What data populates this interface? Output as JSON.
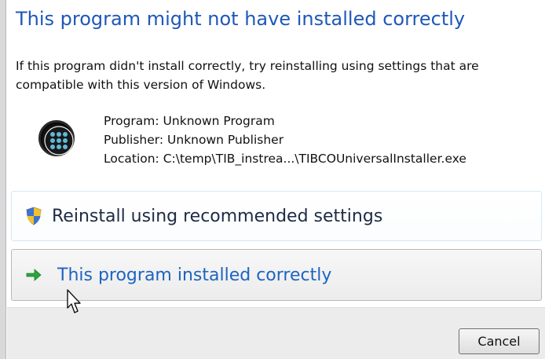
{
  "title": "This program might not have installed correctly",
  "instruction": "If this program didn't install correctly, try reinstalling using settings that are compatible with this version of Windows.",
  "program": {
    "icon": "program-icon",
    "program_label": "Program: Unknown Program",
    "publisher_label": "Publisher: Unknown Publisher",
    "location_label": "Location: C:\\temp\\TIB_instrea...\\TIBCOUniversalInstaller.exe"
  },
  "options": {
    "reinstall": {
      "label": "Reinstall using recommended settings",
      "icon": "shield-icon"
    },
    "installed_correctly": {
      "label": "This program installed correctly",
      "icon": "green-arrow-icon"
    }
  },
  "footer": {
    "cancel_label": "Cancel"
  }
}
